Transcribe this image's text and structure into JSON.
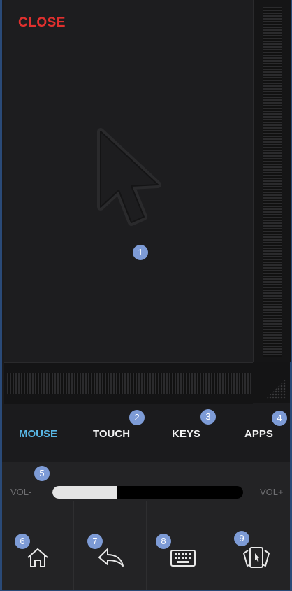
{
  "touchpad": {
    "close_label": "CLOSE",
    "badge": "1"
  },
  "tabs": [
    {
      "label": "MOUSE",
      "active": true,
      "badge": ""
    },
    {
      "label": "TOUCH",
      "active": false,
      "badge": "2"
    },
    {
      "label": "KEYS",
      "active": false,
      "badge": "3"
    },
    {
      "label": "APPS",
      "active": false,
      "badge": "4"
    }
  ],
  "volume": {
    "minus_label": "VOL-",
    "plus_label": "VOL+",
    "level": 0.34,
    "badge": "5"
  },
  "bottom_nav": [
    {
      "icon": "home-icon",
      "badge": "6"
    },
    {
      "icon": "back-icon",
      "badge": "7"
    },
    {
      "icon": "keyboard-icon",
      "badge": "8"
    },
    {
      "icon": "app-switcher-icon",
      "badge": "9"
    }
  ],
  "colors": {
    "close": "#e0302e",
    "active_tab": "#58b6e4",
    "badge": "#7d9bd6"
  }
}
